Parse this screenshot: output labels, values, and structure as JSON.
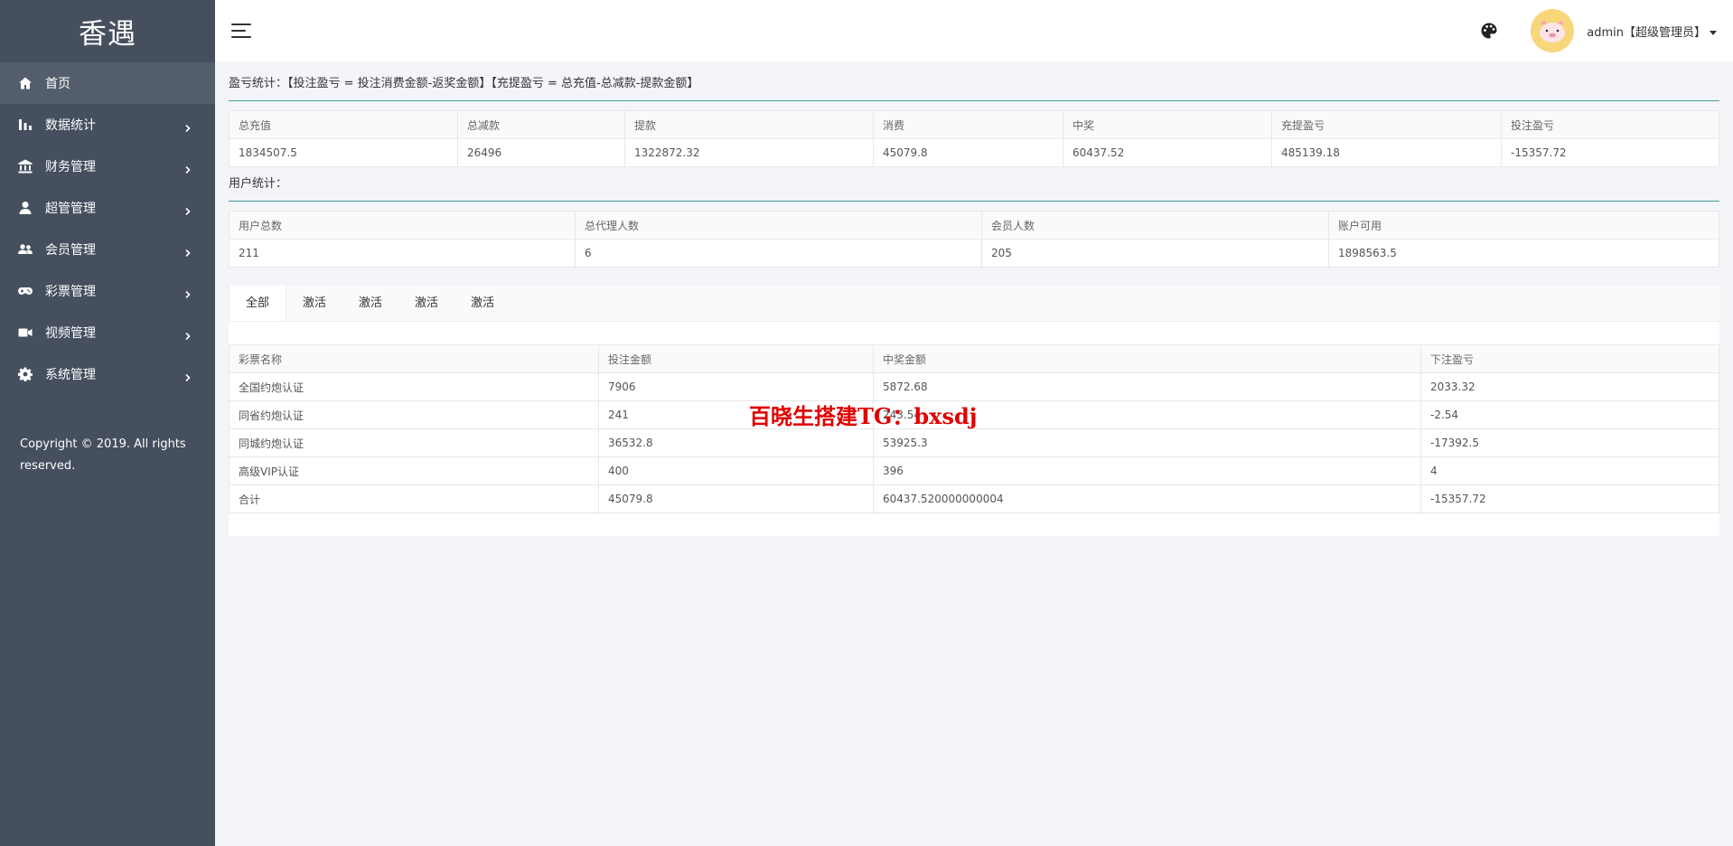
{
  "app": {
    "logo": "香遇"
  },
  "sidebar": {
    "items": [
      {
        "label": "首页",
        "icon": "home-icon",
        "active": true
      },
      {
        "label": "数据统计",
        "icon": "bar-chart-icon"
      },
      {
        "label": "财务管理",
        "icon": "bank-icon"
      },
      {
        "label": "超管管理",
        "icon": "user-icon"
      },
      {
        "label": "会员管理",
        "icon": "users-icon"
      },
      {
        "label": "彩票管理",
        "icon": "gamepad-icon"
      },
      {
        "label": "视频管理",
        "icon": "video-icon"
      },
      {
        "label": "系统管理",
        "icon": "gear-icon"
      }
    ],
    "copyright": "Copyright © 2019. All rights reserved."
  },
  "header": {
    "user": "admin【超级管理员】",
    "icons": [
      "menu-icon",
      "palette-icon",
      "avatar"
    ]
  },
  "profit": {
    "title": "盈亏统计：【投注盈亏 = 投注消费金额-返奖金额】【充提盈亏 = 总充值-总减款-提款金额】",
    "headers": [
      "总充值",
      "总减款",
      "提款",
      "消费",
      "中奖",
      "充提盈亏",
      "投注盈亏"
    ],
    "row": [
      "1834507.5",
      "26496",
      "1322872.32",
      "45079.8",
      "60437.52",
      "485139.18",
      "-15357.72"
    ]
  },
  "users": {
    "title": "用户统计：",
    "headers": [
      "用户总数",
      "总代理人数",
      "会员人数",
      "账户可用"
    ],
    "row": [
      "211",
      "6",
      "205",
      "1898563.5"
    ]
  },
  "tabs": [
    "全部",
    "激活",
    "激活",
    "激活",
    "激活"
  ],
  "lottery": {
    "headers": [
      "彩票名称",
      "投注金额",
      "中奖金额",
      "下注盈亏"
    ],
    "rows": [
      [
        "全国约炮认证",
        "7906",
        "5872.68",
        "2033.32"
      ],
      [
        "同省约炮认证",
        "241",
        "243.54",
        "-2.54"
      ],
      [
        "同城约炮认证",
        "36532.8",
        "53925.3",
        "-17392.5"
      ],
      [
        "高级VIP认证",
        "400",
        "396",
        "4"
      ],
      [
        "合计",
        "45079.8",
        "60437.520000000004",
        "-15357.72"
      ]
    ]
  },
  "watermark": "百晓生搭建TG：bxsdj",
  "colors": {
    "sidebar": "#454f5e",
    "accent": "#4a9b9b",
    "watermark": "#e00000"
  }
}
